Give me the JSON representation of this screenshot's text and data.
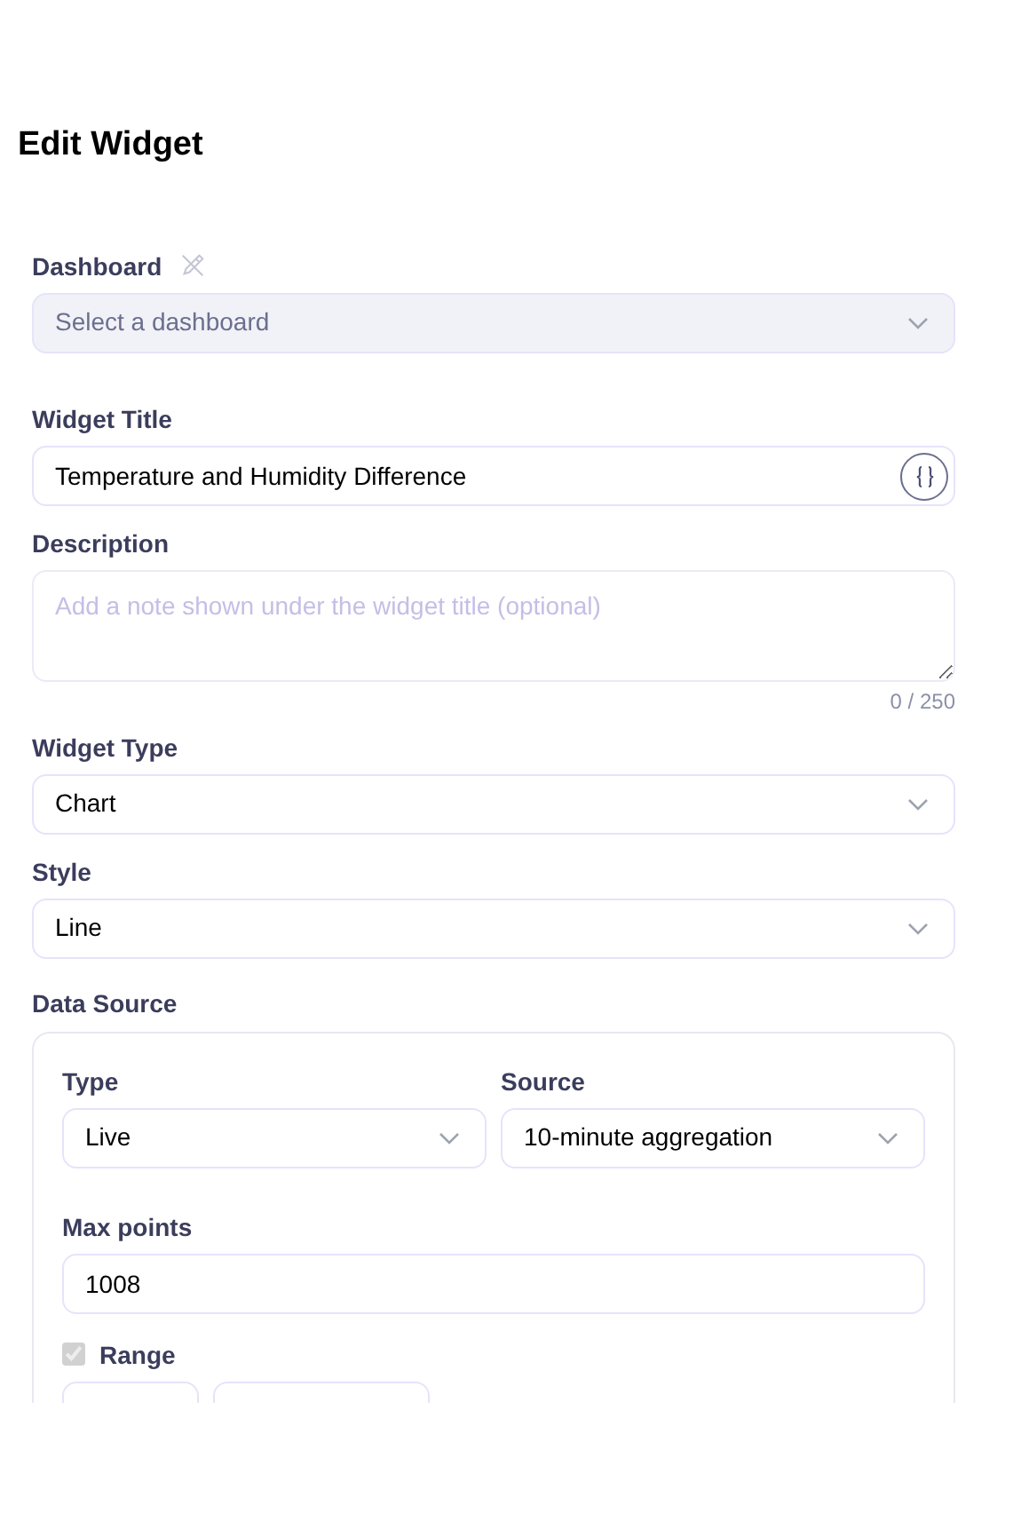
{
  "page": {
    "title": "Edit Widget"
  },
  "dashboard": {
    "label": "Dashboard",
    "placeholder": "Select a dashboard",
    "disabled": true
  },
  "widget_title": {
    "label": "Widget Title",
    "value": "Temperature and Humidity Difference"
  },
  "description": {
    "label": "Description",
    "placeholder": "Add a note shown under the widget title (optional)",
    "counter": "0 / 250"
  },
  "widget_type": {
    "label": "Widget Type",
    "value": "Chart"
  },
  "style": {
    "label": "Style",
    "value": "Line"
  },
  "data_source": {
    "label": "Data Source",
    "type": {
      "label": "Type",
      "value": "Live"
    },
    "source": {
      "label": "Source",
      "value": "10-minute aggregation"
    },
    "max_points": {
      "label": "Max points",
      "value": "1008"
    },
    "range": {
      "label": "Range",
      "checked": true,
      "disabled": true
    }
  }
}
